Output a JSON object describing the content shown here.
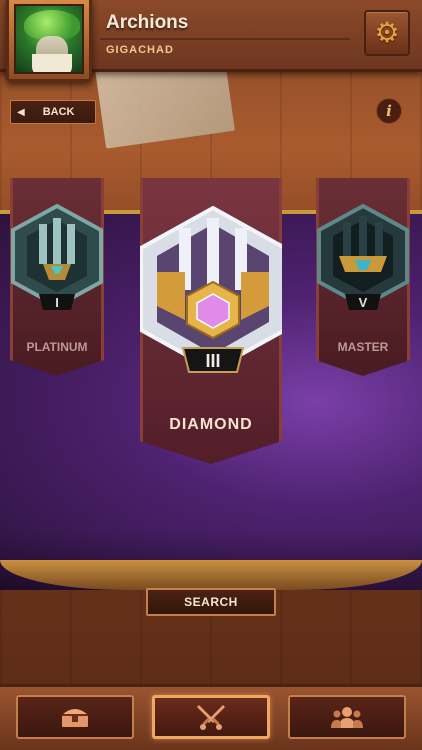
{
  "header": {
    "player_name": "Archions",
    "player_title": "GIGACHAD",
    "avatar_icon": "mushroom-wizard-avatar",
    "settings_icon": "gear-icon"
  },
  "navigation": {
    "back_label": "BACK",
    "info_label": "i"
  },
  "ranks": {
    "left": {
      "tier": "I",
      "label": "PLATINUM"
    },
    "center": {
      "tier": "III",
      "label": "DIAMOND",
      "selected": true
    },
    "right": {
      "tier": "V",
      "label": "MASTER"
    }
  },
  "actions": {
    "search_label": "SEARCH"
  },
  "bottom_nav": {
    "items": [
      {
        "icon": "treasure-chest-icon",
        "active": false
      },
      {
        "icon": "crossed-swords-icon",
        "active": true
      },
      {
        "icon": "group-icon",
        "active": false
      }
    ]
  },
  "colors": {
    "wood": "#8a4a26",
    "cloth_purple": "#4e2270",
    "banner_maroon": "#6a2f36",
    "gold_accent": "#c99a3c",
    "diamond_gem": "#e08be8"
  }
}
